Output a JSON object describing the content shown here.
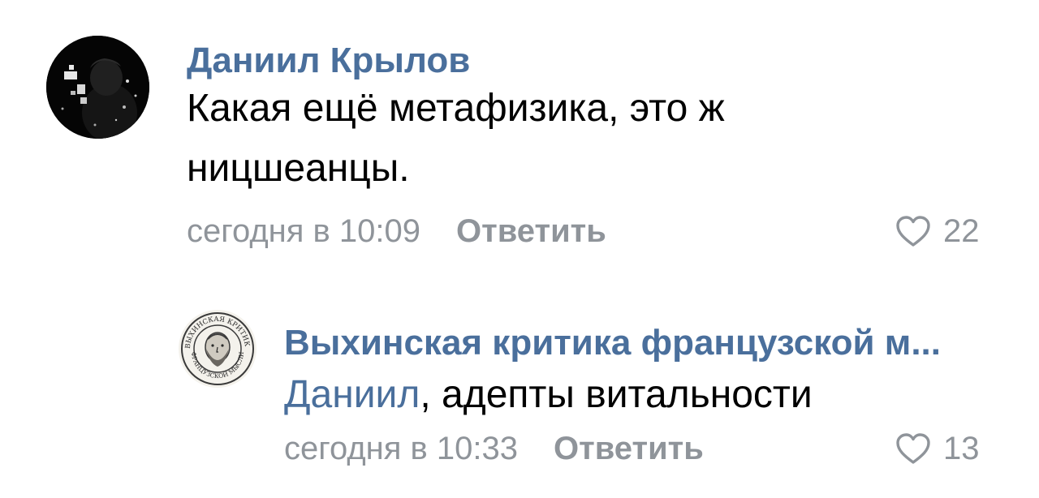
{
  "comments": [
    {
      "author": "Даниил Крылов",
      "text": "Какая ещё метафизика, это ж ницшеанцы.",
      "time": "сегодня в 10:09",
      "reply_label": "Ответить",
      "likes": "22",
      "avatar_icon": "user-avatar-photo"
    },
    {
      "author": "Выхинская критика французской м...",
      "mention": "Даниил",
      "text": ", адепты витальности",
      "time": "сегодня в 10:33",
      "reply_label": "Ответить",
      "likes": "13",
      "avatar_icon": "community-logo-seal",
      "avatar_seal_text_top": "ВЫХИНСКАЯ КРИТИКА",
      "avatar_seal_text_bottom": "ФРАНЦУЗСКОЙ МЫСЛИ"
    }
  ],
  "colors": {
    "link": "#4a6f9c",
    "meta": "#8f949a",
    "text": "#000000"
  },
  "icons": {
    "like": "heart-outline-icon"
  }
}
